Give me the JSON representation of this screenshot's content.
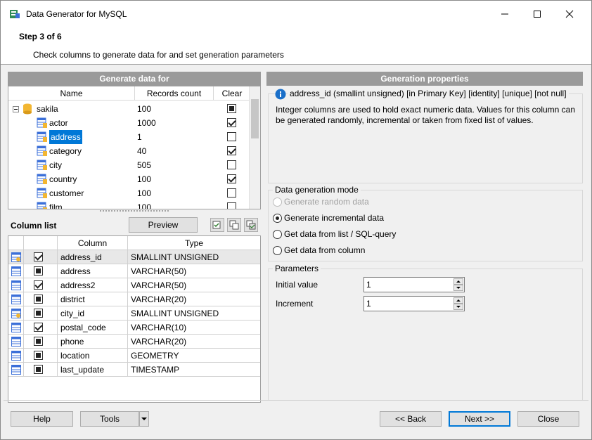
{
  "window": {
    "title": "Data Generator for MySQL"
  },
  "header": {
    "step": "Step 3 of 6",
    "description": "Check columns to generate data for and set generation parameters"
  },
  "left_panel": {
    "title": "Generate data for",
    "columns": {
      "name": "Name",
      "records": "Records count",
      "clear": "Clear"
    },
    "tree": [
      {
        "name": "sakila",
        "records": "100",
        "clear": "filled",
        "type": "database"
      },
      {
        "name": "actor",
        "records": "1000",
        "clear": "checked",
        "type": "table"
      },
      {
        "name": "address",
        "records": "1",
        "clear": "empty",
        "type": "table",
        "selected": true
      },
      {
        "name": "category",
        "records": "40",
        "clear": "checked",
        "type": "table"
      },
      {
        "name": "city",
        "records": "505",
        "clear": "empty",
        "type": "table"
      },
      {
        "name": "country",
        "records": "100",
        "clear": "checked",
        "type": "table"
      },
      {
        "name": "customer",
        "records": "100",
        "clear": "empty",
        "type": "table"
      },
      {
        "name": "film",
        "records": "100",
        "clear": "empty",
        "type": "table"
      }
    ]
  },
  "column_list": {
    "label": "Column list",
    "preview_label": "Preview",
    "headers": {
      "column": "Column",
      "type": "Type"
    },
    "rows": [
      {
        "name": "address_id",
        "type": "SMALLINT UNSIGNED",
        "check": "checked",
        "key": true
      },
      {
        "name": "address",
        "type": "VARCHAR(50)",
        "check": "filled",
        "key": false
      },
      {
        "name": "address2",
        "type": "VARCHAR(50)",
        "check": "checked",
        "key": false
      },
      {
        "name": "district",
        "type": "VARCHAR(20)",
        "check": "filled",
        "key": false
      },
      {
        "name": "city_id",
        "type": "SMALLINT UNSIGNED",
        "check": "filled",
        "key": true
      },
      {
        "name": "postal_code",
        "type": "VARCHAR(10)",
        "check": "checked",
        "key": false
      },
      {
        "name": "phone",
        "type": "VARCHAR(20)",
        "check": "filled",
        "key": false
      },
      {
        "name": "location",
        "type": "GEOMETRY",
        "check": "filled",
        "key": false
      },
      {
        "name": "last_update",
        "type": "TIMESTAMP",
        "check": "filled",
        "key": false
      }
    ]
  },
  "right_panel": {
    "title": "Generation properties",
    "info_title": "address_id (smallint unsigned) [in Primary Key] [identity] [unique] [not null]",
    "info_text": "Integer columns are used to hold exact numeric data. Values for this column can be generated randomly, incremental or taken from fixed list of values.",
    "mode_group": "Data generation mode",
    "modes": [
      {
        "label": "Generate random data",
        "selected": false,
        "disabled": true
      },
      {
        "label": "Generate incremental data",
        "selected": true,
        "disabled": false
      },
      {
        "label": "Get data from list / SQL-query",
        "selected": false,
        "disabled": false
      },
      {
        "label": "Get data from column",
        "selected": false,
        "disabled": false
      }
    ],
    "params_group": "Parameters",
    "initial_label": "Initial value",
    "initial_value": "1",
    "increment_label": "Increment",
    "increment_value": "1"
  },
  "footer": {
    "help": "Help",
    "tools": "Tools",
    "back": "<< Back",
    "next": "Next >>",
    "close": "Close"
  },
  "colors": {
    "accent": "#0078d7",
    "panel_header": "#9a9a9a",
    "info_icon": "#1a6fc9"
  }
}
